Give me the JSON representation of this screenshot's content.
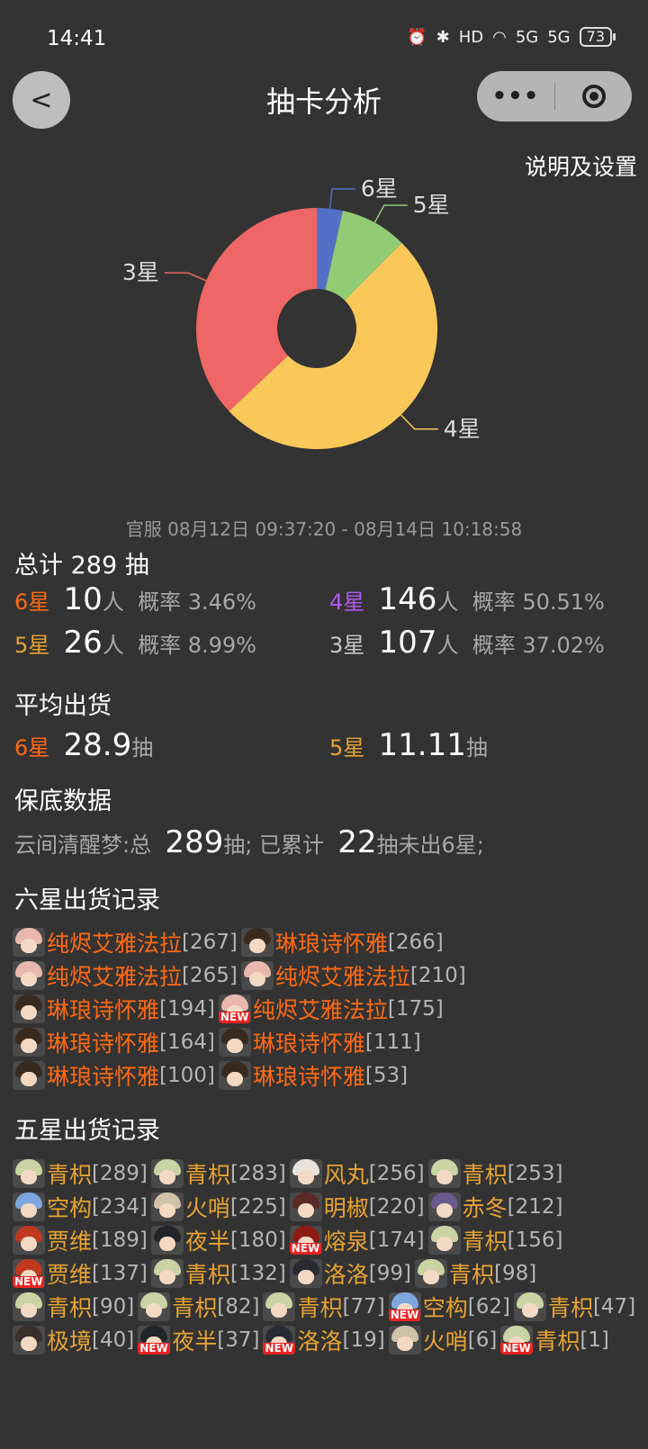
{
  "status_bar": {
    "time": "14:41",
    "battery": "73",
    "hd": "HD",
    "net1": "5G",
    "net2": "5G"
  },
  "header": {
    "title": "抽卡分析",
    "back_glyph": "<",
    "more_glyph": "•••"
  },
  "settings_link": "说明及设置",
  "chart_data": {
    "type": "pie",
    "categories": [
      "6星",
      "5星",
      "4星",
      "3星"
    ],
    "values": [
      10,
      26,
      146,
      107
    ],
    "colors": [
      "#5470c6",
      "#91cc75",
      "#fac858",
      "#ee6666"
    ],
    "donut": true
  },
  "server_line": "官服  08月12日 09:37:20  -  08月14日 10:18:58",
  "total": {
    "label": "总计 289 抽"
  },
  "stats": [
    {
      "star": "6星",
      "count": "10",
      "unit": "人",
      "rate": "概率 3.46%",
      "cls": "c6"
    },
    {
      "star": "4星",
      "count": "146",
      "unit": "人",
      "rate": "概率 50.51%",
      "cls": "c4"
    },
    {
      "star": "5星",
      "count": "26",
      "unit": "人",
      "rate": "概率 8.99%",
      "cls": "c5"
    },
    {
      "star": "3星",
      "count": "107",
      "unit": "人",
      "rate": "概率 37.02%",
      "cls": "c3"
    }
  ],
  "avg": {
    "title": "平均出货",
    "six": {
      "star": "6星",
      "value": "28.9",
      "unit": "抽"
    },
    "five": {
      "star": "5星",
      "value": "11.11",
      "unit": "抽"
    }
  },
  "pity": {
    "title": "保底数据",
    "pool": "云间清醒梦:总",
    "total": "289",
    "mid": "抽;  已累计",
    "count": "22",
    "tail": "抽未出6星;"
  },
  "six_star": {
    "title": "六星出货记录",
    "items": [
      {
        "name": "纯烬艾雅法拉",
        "count": "[267]",
        "hair": "#e9b7ad",
        "new": false
      },
      {
        "name": "琳琅诗怀雅",
        "count": "[266]",
        "hair": "#3a2a1e",
        "new": false
      },
      {
        "name": "纯烬艾雅法拉",
        "count": "[265]",
        "hair": "#e9b7ad",
        "new": false
      },
      {
        "name": "纯烬艾雅法拉",
        "count": "[210]",
        "hair": "#e9b7ad",
        "new": false
      },
      {
        "name": "琳琅诗怀雅",
        "count": "[194]",
        "hair": "#3a2a1e",
        "new": false
      },
      {
        "name": "纯烬艾雅法拉",
        "count": "[175]",
        "hair": "#e9b7ad",
        "new": true
      },
      {
        "name": "琳琅诗怀雅",
        "count": "[164]",
        "hair": "#3a2a1e",
        "new": false
      },
      {
        "name": "琳琅诗怀雅",
        "count": "[111]",
        "hair": "#3a2a1e",
        "new": false
      },
      {
        "name": "琳琅诗怀雅",
        "count": "[100]",
        "hair": "#3a2a1e",
        "new": false
      },
      {
        "name": "琳琅诗怀雅",
        "count": "[53]",
        "hair": "#3a2a1e",
        "new": false
      }
    ]
  },
  "five_star": {
    "title": "五星出货记录",
    "items": [
      {
        "name": "青枳",
        "count": "[289]",
        "hair": "#c9d3a4",
        "new": false
      },
      {
        "name": "青枳",
        "count": "[283]",
        "hair": "#c9d3a4",
        "new": false
      },
      {
        "name": "风丸",
        "count": "[256]",
        "hair": "#e9e2da",
        "new": false
      },
      {
        "name": "青枳",
        "count": "[253]",
        "hair": "#c9d3a4",
        "new": false
      },
      {
        "name": "空构",
        "count": "[234]",
        "hair": "#7ea7e0",
        "new": false
      },
      {
        "name": "火哨",
        "count": "[225]",
        "hair": "#cfc2a8",
        "new": false
      },
      {
        "name": "明椒",
        "count": "[220]",
        "hair": "#5b2a26",
        "new": false
      },
      {
        "name": "赤冬",
        "count": "[212]",
        "hair": "#6b5a8f",
        "new": false
      },
      {
        "name": "贾维",
        "count": "[189]",
        "hair": "#c0391f",
        "new": false
      },
      {
        "name": "夜半",
        "count": "[180]",
        "hair": "#222428",
        "new": false
      },
      {
        "name": "熔泉",
        "count": "[174]",
        "hair": "#8a1c14",
        "new": true
      },
      {
        "name": "青枳",
        "count": "[156]",
        "hair": "#c9d3a4",
        "new": false
      },
      {
        "name": "贾维",
        "count": "[137]",
        "hair": "#c0391f",
        "new": true
      },
      {
        "name": "青枳",
        "count": "[132]",
        "hair": "#c9d3a4",
        "new": false
      },
      {
        "name": "洛洛",
        "count": "[99]",
        "hair": "#2a2a33",
        "new": false
      },
      {
        "name": "青枳",
        "count": "[98]",
        "hair": "#c9d3a4",
        "new": false
      },
      {
        "name": "青枳",
        "count": "[90]",
        "hair": "#c9d3a4",
        "new": false
      },
      {
        "name": "青枳",
        "count": "[82]",
        "hair": "#c9d3a4",
        "new": false
      },
      {
        "name": "青枳",
        "count": "[77]",
        "hair": "#c9d3a4",
        "new": false
      },
      {
        "name": "空构",
        "count": "[62]",
        "hair": "#7ea7e0",
        "new": true
      },
      {
        "name": "青枳",
        "count": "[47]",
        "hair": "#c9d3a4",
        "new": false
      },
      {
        "name": "极境",
        "count": "[40]",
        "hair": "#3b2f2c",
        "new": false
      },
      {
        "name": "夜半",
        "count": "[37]",
        "hair": "#222428",
        "new": true
      },
      {
        "name": "洛洛",
        "count": "[19]",
        "hair": "#2a2a33",
        "new": true
      },
      {
        "name": "火哨",
        "count": "[6]",
        "hair": "#cfc2a8",
        "new": false
      },
      {
        "name": "青枳",
        "count": "[1]",
        "hair": "#c9d3a4",
        "new": true
      }
    ]
  },
  "new_badge": "NEW"
}
